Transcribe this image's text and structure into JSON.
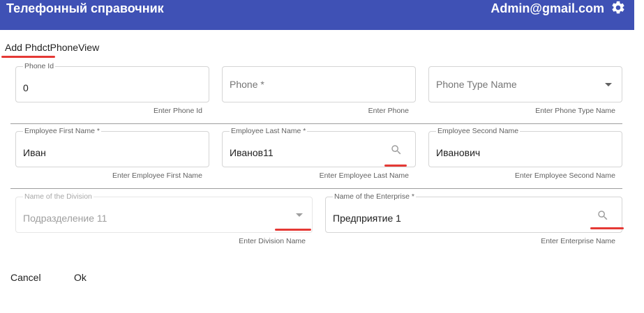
{
  "header": {
    "app_title": "Телефонный справочник",
    "user_email": "Admin@gmail.com",
    "settings_icon": "gear-icon",
    "bg_color": "#3f51b5"
  },
  "form": {
    "title": "Add PhdctPhoneView",
    "fields": {
      "phone_id": {
        "label": "Phone Id",
        "value": "0",
        "hint": "Enter Phone Id"
      },
      "phone": {
        "placeholder": "Phone *",
        "hint": "Enter Phone"
      },
      "phone_type_name": {
        "placeholder": "Phone Type Name",
        "hint": "Enter Phone Type Name",
        "icon": "chevron-down-icon"
      },
      "employee_first_name": {
        "label": "Employee First Name *",
        "value": "Иван",
        "hint": "Enter Employee First Name"
      },
      "employee_last_name": {
        "label": "Employee Last Name *",
        "value": "Иванов11",
        "hint": "Enter Employee Last Name",
        "icon": "search-icon"
      },
      "employee_second_name": {
        "label": "Employee Second Name",
        "value": "Иванович",
        "hint": "Enter Employee Second Name"
      },
      "division_name": {
        "label": "Name of the Division",
        "value": "Подразделение 11",
        "hint": "Enter Division Name",
        "icon": "chevron-down-icon",
        "disabled": true
      },
      "enterprise_name": {
        "label": "Name of the Enterprise *",
        "value": "Предприятие 1",
        "hint": "Enter Enterprise Name",
        "icon": "search-icon"
      }
    }
  },
  "actions": {
    "cancel_label": "Cancel",
    "ok_label": "Ok"
  },
  "annotation_color": "#e53935"
}
